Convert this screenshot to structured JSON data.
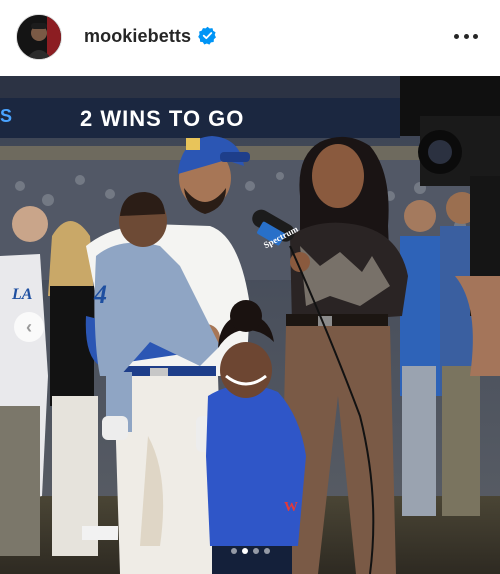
{
  "post": {
    "username": "mookiebetts",
    "verified": true,
    "avatar_icon": "avatar-photo",
    "more_icon": "more-horizontal-icon"
  },
  "photo": {
    "scoreboard_text": "2 WINS TO GO",
    "scoreboard_left_text": "S",
    "jersey_left_text": "LA",
    "jersey_main_text": "4",
    "mic_flag_text": "Spectrum",
    "jacket_text": "W"
  },
  "carousel": {
    "prev_icon": "chevron-left-icon",
    "slide_count": 4,
    "active_slide": 2
  },
  "colors": {
    "dodger_blue": "#1e4fa0",
    "verified_blue": "#0095f6",
    "text": "#262626"
  }
}
